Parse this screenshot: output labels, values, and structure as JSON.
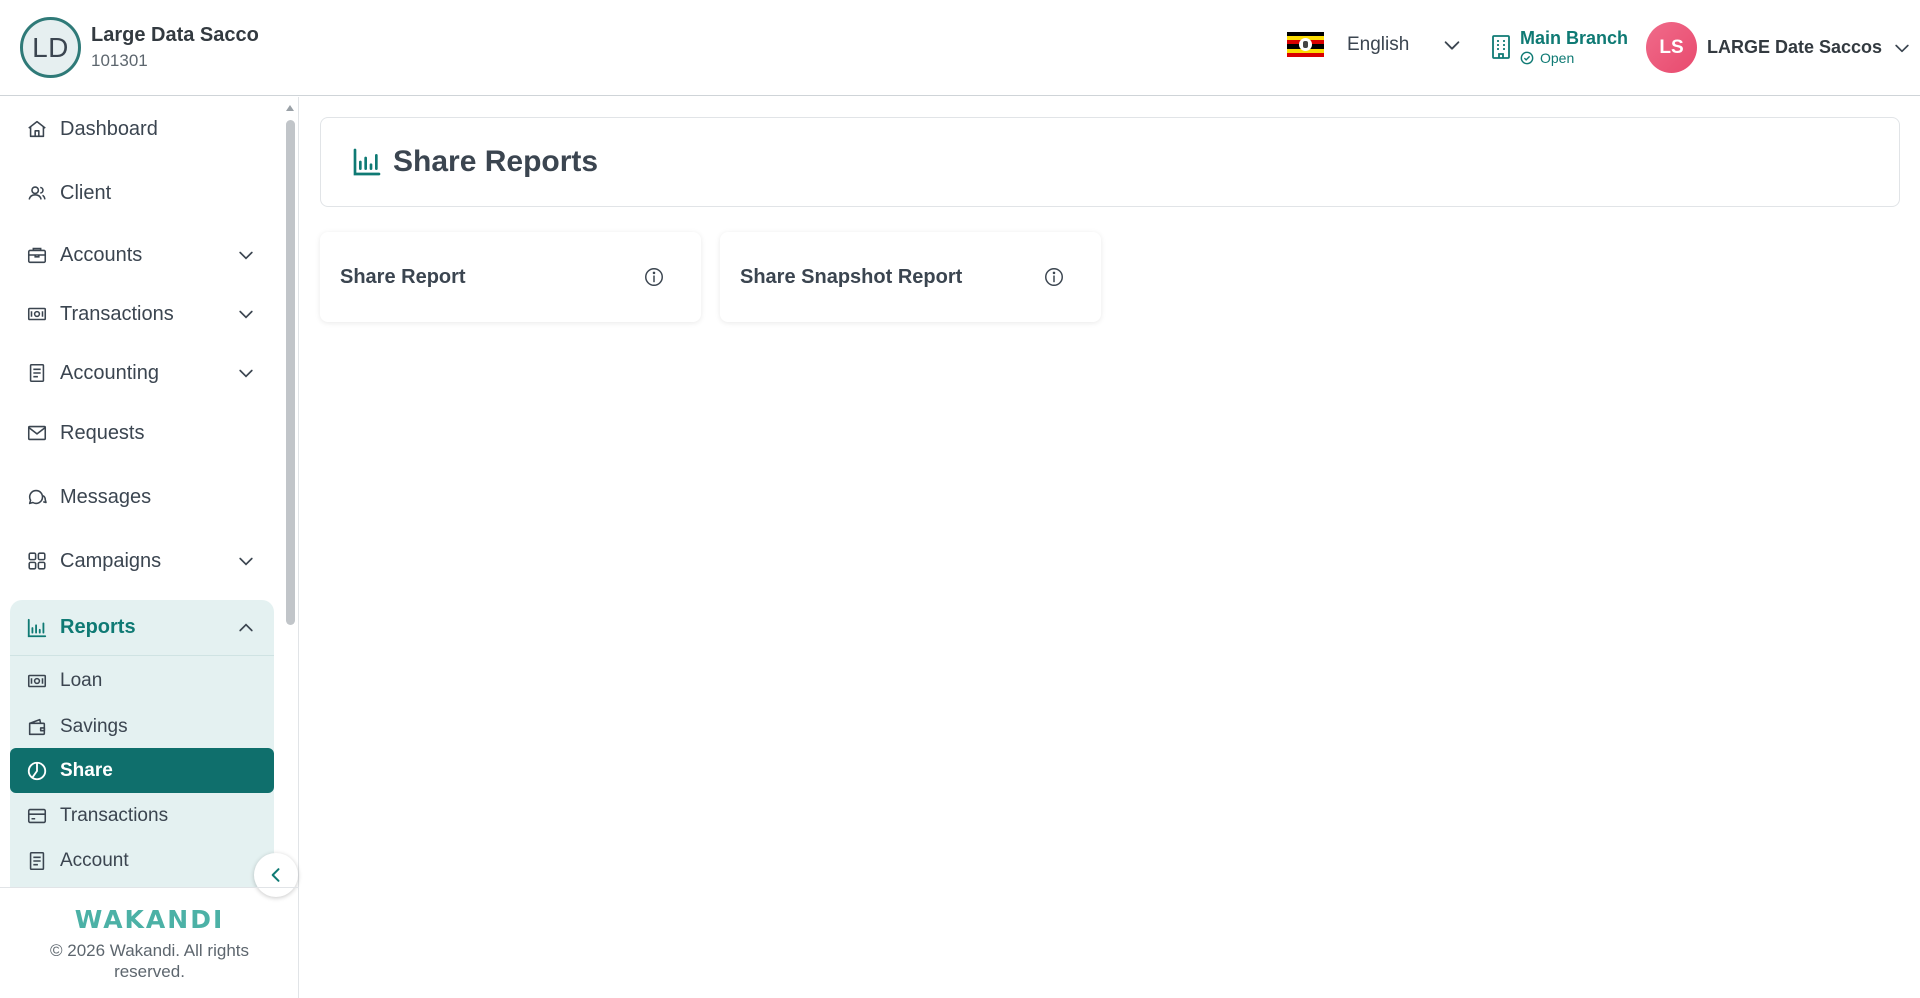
{
  "header": {
    "org_initials": "LD",
    "org_name": "Large Data Sacco",
    "org_code": "101301",
    "language": "English",
    "branch_name": "Main Branch",
    "branch_status": "Open",
    "user_initials": "LS",
    "user_name": "LARGE Date Saccos",
    "icons": {
      "flag": "uganda-flag-icon",
      "branch": "building-icon",
      "status": "check-circle-icon"
    }
  },
  "sidebar": {
    "items": [
      {
        "label": "Dashboard",
        "icon": "home-icon"
      },
      {
        "label": "Client",
        "icon": "users-icon"
      },
      {
        "label": "Accounts",
        "icon": "briefcase-icon",
        "expandable": true
      },
      {
        "label": "Transactions",
        "icon": "money-icon",
        "expandable": true
      },
      {
        "label": "Accounting",
        "icon": "ledger-icon",
        "expandable": true
      },
      {
        "label": "Requests",
        "icon": "mail-icon"
      },
      {
        "label": "Messages",
        "icon": "chat-icon"
      },
      {
        "label": "Campaigns",
        "icon": "grid-icon",
        "expandable": true
      }
    ],
    "reports": {
      "label": "Reports",
      "icon": "bar-chart-icon",
      "expanded": true,
      "sub_items": [
        {
          "label": "Loan",
          "icon": "money-icon"
        },
        {
          "label": "Savings",
          "icon": "wallet-icon"
        },
        {
          "label": "Share",
          "icon": "pie-chart-icon",
          "active": true
        },
        {
          "label": "Transactions",
          "icon": "card-icon"
        },
        {
          "label": "Account",
          "icon": "ledger-icon"
        }
      ]
    },
    "footer": {
      "brand": "WAKANDI",
      "copyright": "© 2026 Wakandi. All rights reserved."
    }
  },
  "main": {
    "title": "Share Reports",
    "cards": [
      {
        "label": "Share Report"
      },
      {
        "label": "Share Snapshot Report"
      }
    ]
  },
  "colors": {
    "primary": "#0f7a74",
    "active_bg": "#0f6f6c",
    "reports_bg": "#e4f1f1",
    "brand": "#4cb1a6",
    "avatar": "#e84a6e",
    "text": "#3b4550"
  }
}
